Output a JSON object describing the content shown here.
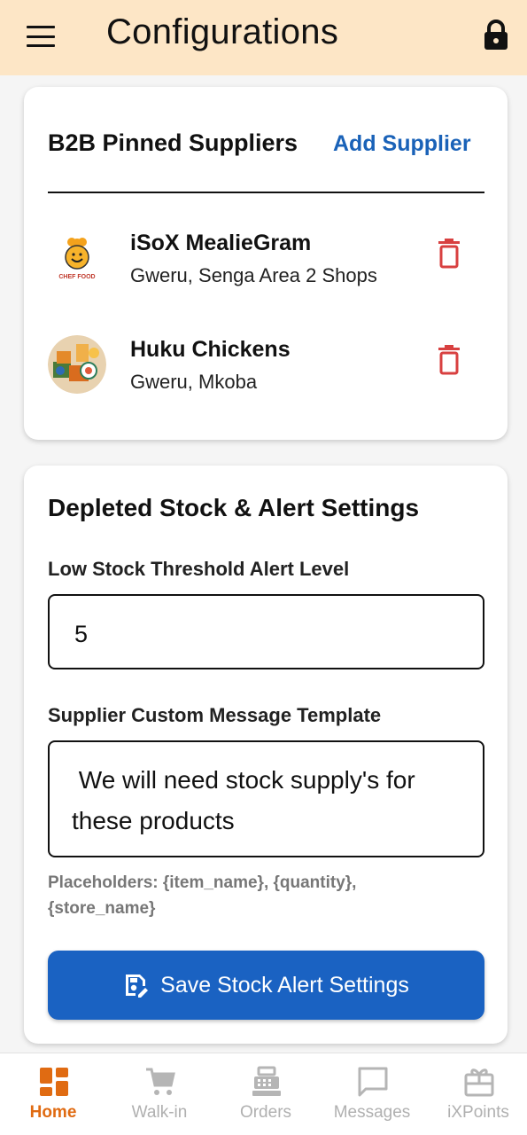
{
  "appbar": {
    "title": "Configurations",
    "menu_icon": "menu-icon",
    "lock_icon": "lock-icon",
    "bg_color": "#fde6c6"
  },
  "suppliers_card": {
    "title": "B2B Pinned Suppliers",
    "add_label": "Add Supplier",
    "items": [
      {
        "name": "iSoX MealieGram",
        "location": "Gweru, Senga Area 2 Shops",
        "logo_text": "CHEF FOOD"
      },
      {
        "name": "Huku Chickens",
        "location": "Gweru, Mkoba"
      }
    ],
    "delete_color": "#d84040"
  },
  "alert_card": {
    "title": "Depleted Stock & Alert Settings",
    "threshold_label": "Low Stock Threshold Alert Level",
    "threshold_value": "5",
    "template_label": "Supplier Custom Message Template",
    "template_value": " We will need stock supply's for these products",
    "placeholders_hint": "Placeholders: {item_name}, {quantity}, {store_name}",
    "save_label": "Save Stock Alert Settings",
    "button_color": "#1a62c2"
  },
  "bottom_nav": {
    "items": [
      {
        "label": "Home",
        "icon": "home-grid-icon",
        "active": true
      },
      {
        "label": "Walk-in",
        "icon": "cart-icon",
        "active": false
      },
      {
        "label": "Orders",
        "icon": "register-icon",
        "active": false
      },
      {
        "label": "Messages",
        "icon": "message-icon",
        "active": false
      },
      {
        "label": "iXPoints",
        "icon": "gift-icon",
        "active": false
      }
    ],
    "active_color": "#e06b12"
  }
}
